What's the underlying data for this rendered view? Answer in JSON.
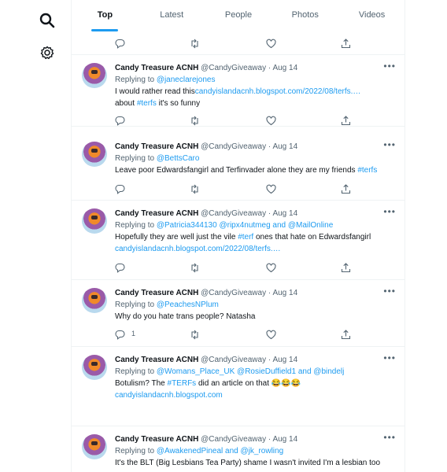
{
  "tabs": [
    {
      "label": "Top"
    },
    {
      "label": "Latest"
    },
    {
      "label": "People"
    },
    {
      "label": "Photos"
    },
    {
      "label": "Videos"
    }
  ],
  "tweets": [
    {
      "name": "Candy Treasure ACNH",
      "handle": "@CandyGiveaway",
      "date": "Aug 14",
      "replying_label": "Replying to",
      "replying_to": "@janeclarejones",
      "text_before": "I would rather read this",
      "link": "candyislandacnh.blogspot.com/2022/08/terfs.…",
      "text_line2_pre": "about ",
      "hashtag": "#terfs",
      "text_line2_post": " it's so funny"
    },
    {
      "name": "Candy Treasure ACNH",
      "handle": "@CandyGiveaway",
      "date": "Aug 14",
      "replying_label": "Replying to",
      "replying_to": "@BettsCaro",
      "text": "Leave poor Edwardsfangirl and Terfinvader alone they are my friends ",
      "hashtag": "#terfs"
    },
    {
      "name": "Candy Treasure ACNH",
      "handle": "@CandyGiveaway",
      "date": "Aug 14",
      "replying_label": "Replying to",
      "replying_to": "@Patricia344130 @ripx4nutmeg and @MailOnline",
      "text_pre": "Hopefully they are well just the vile ",
      "hashtag": "#terf",
      "text_post": " ones that hate on Edwardsfangirl",
      "link": "candyislandacnh.blogspot.com/2022/08/terfs.…"
    },
    {
      "name": "Candy Treasure ACNH",
      "handle": "@CandyGiveaway",
      "date": "Aug 14",
      "replying_label": "Replying to",
      "replying_to": "@PeachesNPlum",
      "text": "Why do you hate trans people? Natasha",
      "reply_count": "1"
    },
    {
      "name": "Candy Treasure ACNH",
      "handle": "@CandyGiveaway",
      "date": "Aug 14",
      "replying_label": "Replying to",
      "replying_to": "@Womans_Place_UK @RosieDuffield1 and @bindelj",
      "text_pre": "Botulism? The ",
      "hashtag": "#TERFs",
      "text_post": " did an article on that 😂😂😂",
      "link": "candyislandacnh.blogspot.com"
    },
    {
      "name": "Candy Treasure ACNH",
      "handle": "@CandyGiveaway",
      "date": "Aug 14",
      "replying_label": "Replying to",
      "replying_to": "@AwakenedPineal and @jk_rowling",
      "text": "It's the BLT (Big Lesbians Tea Party) shame I wasn't invited I'm a lesbian too"
    }
  ],
  "icons": {
    "search": "search-icon",
    "settings": "gear-icon",
    "reply": "reply-icon",
    "retweet": "retweet-icon",
    "like": "heart-icon",
    "share": "share-icon",
    "more": "more-icon"
  },
  "colors": {
    "accent": "#1d9bf0",
    "muted": "#536471",
    "text": "#0f1419",
    "border": "#eff3f4"
  }
}
